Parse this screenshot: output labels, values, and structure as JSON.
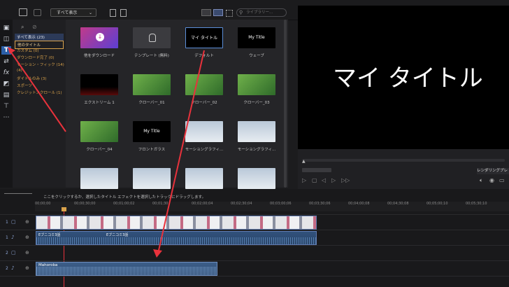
{
  "top": {
    "dropdown": "すべて表示",
    "search_placeholder": "ライブラリー..."
  },
  "categories": [
    {
      "label": "すべて表示 (23)",
      "state": "selected"
    },
    {
      "label": "他のタイトル",
      "state": "active"
    },
    {
      "label": "カスタム (0)",
      "state": "normal"
    },
    {
      "label": "ダウンロード完了 (0)",
      "state": "normal"
    },
    {
      "label": "モーション・フィック (14)",
      "state": "normal"
    },
    {
      "label": "(4)",
      "state": "normal"
    },
    {
      "label": "ダイトルのみ (3)",
      "state": "normal"
    },
    {
      "label": "スポーツ",
      "state": "normal"
    },
    {
      "label": "クレジットスクロール (1)",
      "state": "normal"
    }
  ],
  "library": [
    {
      "label": "他をダウンロード",
      "thumb_text": "",
      "style": "pink"
    },
    {
      "label": "テンプレート (無料)",
      "thumb_text": "",
      "style": "darkicon"
    },
    {
      "label": "デフォルト",
      "thumb_text": "マイ タイトル",
      "style": "black"
    },
    {
      "label": "ウェーブ",
      "thumb_text": "My Title",
      "style": "black"
    },
    {
      "label": "エクストリーム 1",
      "thumb_text": "",
      "style": "blackred"
    },
    {
      "label": "クローバー_01",
      "thumb_text": "",
      "style": "green"
    },
    {
      "label": "クローバー_02",
      "thumb_text": "",
      "style": "green"
    },
    {
      "label": "クローバー_03",
      "thumb_text": "",
      "style": "green"
    },
    {
      "label": "クローバー_04",
      "thumb_text": "",
      "style": "green"
    },
    {
      "label": "フロントガラス",
      "thumb_text": "My Title",
      "style": "black"
    },
    {
      "label": "モーショングラフィ...",
      "thumb_text": "",
      "style": "sky"
    },
    {
      "label": "モーショングラフィ...",
      "thumb_text": "",
      "style": "sky"
    },
    {
      "label": "",
      "thumb_text": "",
      "style": "sky"
    },
    {
      "label": "",
      "thumb_text": "",
      "style": "sky"
    },
    {
      "label": "",
      "thumb_text": "",
      "style": "sky"
    },
    {
      "label": "",
      "thumb_text": "",
      "style": "sky"
    }
  ],
  "preview": {
    "title": "マイ タイトル",
    "render_label": "レンダリングプレ"
  },
  "timeline": {
    "hint": "ここをクリックするか、選択したタイトル エフェクトを選択したトラックにドラッグします。",
    "ruler": [
      "00;00;00",
      "00;00;30;00",
      "00;01;00;02",
      "00;01;30",
      "00;02;00;04",
      "00;02;30;04",
      "00;03;00;06",
      "00;03;30;06",
      "00;04;00;08",
      "00;04;30;08",
      "00;05;00;10",
      "00;05;30;10"
    ],
    "video_clip": "Eブニコミ3話",
    "audio_clip": "Mahoroba",
    "track_labels": [
      "1",
      "1",
      "2",
      "2"
    ]
  },
  "colors": {
    "accent_red": "#e8323c",
    "category_orange": "#d9a24b",
    "selection_blue": "#2c3a58"
  }
}
